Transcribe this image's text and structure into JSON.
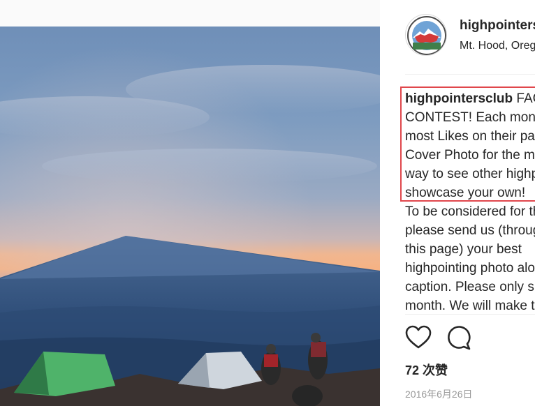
{
  "post": {
    "photo": {
      "description_icon": "mountain-shadow-photo"
    },
    "author": {
      "username": "highpointersclub",
      "location": "Mt. Hood, Oregon",
      "avatar_icon": "highpointers-club-logo"
    },
    "caption": {
      "username": "highpointersclub",
      "lines": [
        " FACEBOOK COVER PHOTO",
        "CONTEST! Each month, the photo with the",
        "most Likes on their page will become our",
        "Cover Photo for the month. It's a great",
        "way to see other highpointers' photos and",
        "showcase your own!",
        "To be considered for this month's contest,",
        "please send us (through the message link on",
        "this page) your best",
        "highpointing photo along with a short",
        "caption. Please only submit one photo per",
        "month. We will make the selections..."
      ]
    },
    "actions": {
      "like_icon": "heart-icon",
      "comment_icon": "comment-icon"
    },
    "likes_text": "72 次赞",
    "date_text": "2016年6月26日"
  },
  "colors": {
    "highlight_border": "#e0474c",
    "text": "#262626",
    "muted": "#999999"
  }
}
